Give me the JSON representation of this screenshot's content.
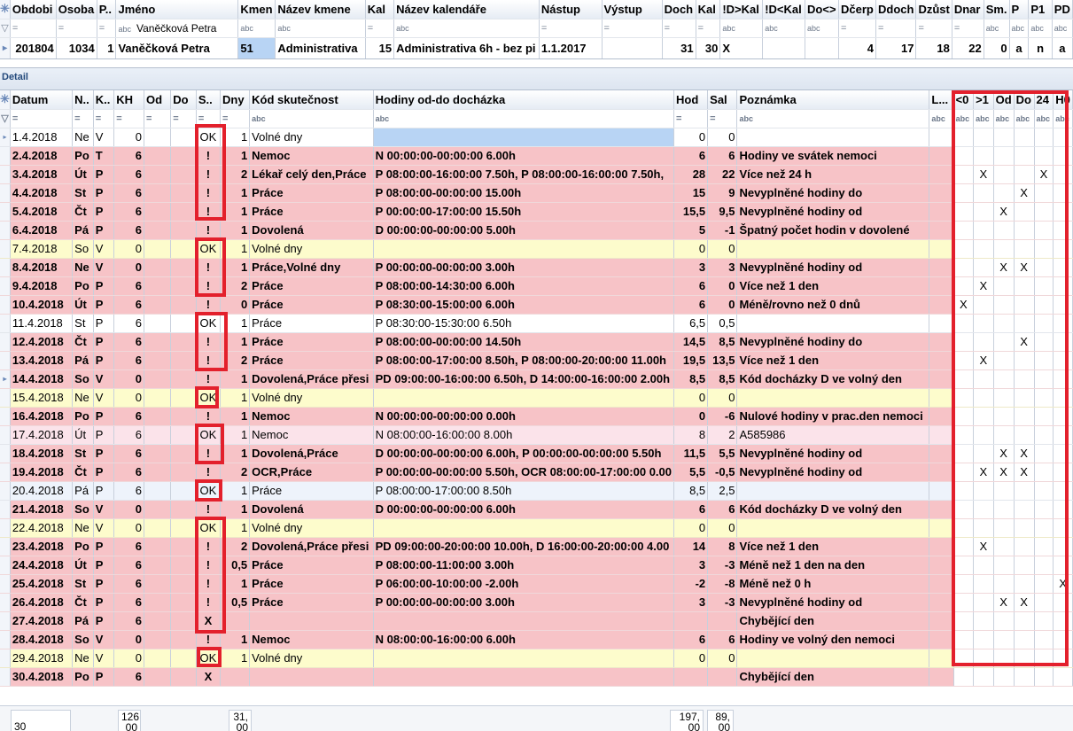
{
  "top_table": {
    "headers": [
      "Obdobi",
      "Osoba",
      "P..",
      "Jméno",
      "Kmen",
      "Název kmene",
      "Kal",
      "Název kalendáře",
      "Nástup",
      "Výstup",
      "Doch",
      "Kal",
      "!D>Kal",
      "!D<Kal",
      "Do<>",
      "Dčerp",
      "Ddoch",
      "Dzůst",
      "Dnar",
      "Sm.",
      "P",
      "P1",
      "PD"
    ],
    "filter": [
      "=",
      "=",
      "=",
      "Vaněčková Petra",
      "abc",
      "abc",
      "=",
      "abc",
      "=",
      "=",
      "=",
      "=",
      "abc",
      "abc",
      "abc",
      "=",
      "=",
      "=",
      "=",
      "abc",
      "abc",
      "abc",
      "abc"
    ],
    "filter_name_prefix": "abc",
    "row": [
      "201804",
      "1034",
      "1",
      "Vaněčková Petra",
      "51",
      "Administrativa",
      "15",
      "Administrativa 6h - bez pi",
      "1.1.2017",
      "",
      "31",
      "30",
      "X",
      "",
      "",
      "4",
      "17",
      "18",
      "22",
      "0",
      "a",
      "n",
      "a"
    ]
  },
  "detail_title": "Detail",
  "detail": {
    "headers": [
      "Datum",
      "N..",
      "K..",
      "KH",
      "Od",
      "Do",
      "S..",
      "Dny",
      "Kód skutečnost",
      "Hodiny od-do docházka",
      "Hod",
      "Sal",
      "Poznámka",
      "L...",
      "<0",
      ">1",
      "Od",
      "Do",
      "24",
      "H0"
    ],
    "filter": [
      "=",
      "=",
      "=",
      "=",
      "=",
      "=",
      "=",
      "=",
      "abc",
      "abc",
      "=",
      "=",
      "abc",
      "abc",
      "abc",
      "abc",
      "abc",
      "abc",
      "abc",
      "abc"
    ],
    "rows": [
      {
        "style": "white",
        "c": [
          "1.4.2018",
          "Ne",
          "V",
          "0",
          "",
          "",
          "OK",
          "1",
          "Volné dny",
          "",
          "0",
          "0",
          "",
          "",
          "",
          "",
          "",
          "",
          "",
          ""
        ]
      },
      {
        "style": "pink",
        "c": [
          "2.4.2018",
          "Po",
          "T",
          "6",
          "",
          "",
          "!",
          "1",
          "Nemoc",
          "N 00:00:00-00:00:00 6.00h",
          "6",
          "6",
          "Hodiny ve svátek nemoci",
          "",
          "",
          "",
          "",
          "",
          "",
          ""
        ]
      },
      {
        "style": "pink",
        "c": [
          "3.4.2018",
          "Út",
          "P",
          "6",
          "",
          "",
          "!",
          "2",
          "Lékař celý den,Práce",
          "P 08:00:00-16:00:00 7.50h, P 08:00:00-16:00:00 7.50h,",
          "28",
          "22",
          "Více než 24 h",
          "",
          "",
          "X",
          "",
          "",
          "X",
          ""
        ]
      },
      {
        "style": "pink",
        "c": [
          "4.4.2018",
          "St",
          "P",
          "6",
          "",
          "",
          "!",
          "1",
          "Práce",
          "P 08:00:00-00:00:00 15.00h",
          "15",
          "9",
          "Nevyplněné hodiny do",
          "",
          "",
          "",
          "",
          "X",
          "",
          ""
        ]
      },
      {
        "style": "pink",
        "c": [
          "5.4.2018",
          "Čt",
          "P",
          "6",
          "",
          "",
          "!",
          "1",
          "Práce",
          "P 00:00:00-17:00:00 15.50h",
          "15,5",
          "9,5",
          "Nevyplněné hodiny od",
          "",
          "",
          "",
          "X",
          "",
          "",
          ""
        ]
      },
      {
        "style": "pink",
        "c": [
          "6.4.2018",
          "Pá",
          "P",
          "6",
          "",
          "",
          "!",
          "1",
          "Dovolená",
          "D 00:00:00-00:00:00 5.00h",
          "5",
          "-1",
          "Špatný počet hodin v dovolené",
          "",
          "",
          "",
          "",
          "",
          "",
          ""
        ]
      },
      {
        "style": "yellow",
        "c": [
          "7.4.2018",
          "So",
          "V",
          "0",
          "",
          "",
          "OK",
          "1",
          "Volné dny",
          "",
          "0",
          "0",
          "",
          "",
          "",
          "",
          "",
          "",
          "",
          ""
        ]
      },
      {
        "style": "pink",
        "c": [
          "8.4.2018",
          "Ne",
          "V",
          "0",
          "",
          "",
          "!",
          "1",
          "Práce,Volné dny",
          "P 00:00:00-00:00:00 3.00h",
          "3",
          "3",
          "Nevyplněné hodiny od",
          "",
          "",
          "",
          "X",
          "X",
          "",
          ""
        ]
      },
      {
        "style": "pink",
        "c": [
          "9.4.2018",
          "Po",
          "P",
          "6",
          "",
          "",
          "!",
          "2",
          "Práce",
          "P 08:00:00-14:30:00 6.00h",
          "6",
          "0",
          "Více než 1 den",
          "",
          "",
          "X",
          "",
          "",
          "",
          ""
        ]
      },
      {
        "style": "pink",
        "c": [
          "10.4.2018",
          "Út",
          "P",
          "6",
          "",
          "",
          "!",
          "0",
          "Práce",
          "P 08:30:00-15:00:00 6.00h",
          "6",
          "0",
          "Méně/rovno než 0 dnů",
          "",
          "X",
          "",
          "",
          "",
          "",
          ""
        ]
      },
      {
        "style": "white",
        "c": [
          "11.4.2018",
          "St",
          "P",
          "6",
          "",
          "",
          "OK",
          "1",
          "Práce",
          "P 08:30:00-15:30:00 6.50h",
          "6,5",
          "0,5",
          "",
          "",
          "",
          "",
          "",
          "",
          "",
          ""
        ]
      },
      {
        "style": "pink",
        "c": [
          "12.4.2018",
          "Čt",
          "P",
          "6",
          "",
          "",
          "!",
          "1",
          "Práce",
          "P 08:00:00-00:00:00 14.50h",
          "14,5",
          "8,5",
          "Nevyplněné hodiny do",
          "",
          "",
          "",
          "",
          "X",
          "",
          ""
        ]
      },
      {
        "style": "pink",
        "c": [
          "13.4.2018",
          "Pá",
          "P",
          "6",
          "",
          "",
          "!",
          "2",
          "Práce",
          "P 08:00:00-17:00:00 8.50h, P 08:00:00-20:00:00 11.00h",
          "19,5",
          "13,5",
          "Více než 1 den",
          "",
          "",
          "X",
          "",
          "",
          "",
          ""
        ]
      },
      {
        "style": "pink",
        "c": [
          "14.4.2018",
          "So",
          "V",
          "0",
          "",
          "",
          "!",
          "1",
          "Dovolená,Práce přesi",
          "PD 09:00:00-16:00:00 6.50h, D 14:00:00-16:00:00 2.00h",
          "8,5",
          "8,5",
          "Kód docházky D ve volný den",
          "",
          "",
          "",
          "",
          "",
          "",
          ""
        ]
      },
      {
        "style": "yellow",
        "c": [
          "15.4.2018",
          "Ne",
          "V",
          "0",
          "",
          "",
          "OK",
          "1",
          "Volné dny",
          "",
          "0",
          "0",
          "",
          "",
          "",
          "",
          "",
          "",
          "",
          ""
        ]
      },
      {
        "style": "pink",
        "c": [
          "16.4.2018",
          "Po",
          "P",
          "6",
          "",
          "",
          "!",
          "1",
          "Nemoc",
          "N 00:00:00-00:00:00 0.00h",
          "0",
          "-6",
          "Nulové hodiny v prac.den nemoci",
          "",
          "",
          "",
          "",
          "",
          "",
          ""
        ]
      },
      {
        "style": "lpink",
        "c": [
          "17.4.2018",
          "Út",
          "P",
          "6",
          "",
          "",
          "OK",
          "1",
          "Nemoc",
          "N 08:00:00-16:00:00 8.00h",
          "8",
          "2",
          "A585986",
          "",
          "",
          "",
          "",
          "",
          "",
          ""
        ]
      },
      {
        "style": "pink",
        "c": [
          "18.4.2018",
          "St",
          "P",
          "6",
          "",
          "",
          "!",
          "1",
          "Dovolená,Práce",
          "D 00:00:00-00:00:00 6.00h, P 00:00:00-00:00:00 5.50h",
          "11,5",
          "5,5",
          "Nevyplněné hodiny od",
          "",
          "",
          "",
          "X",
          "X",
          "",
          ""
        ]
      },
      {
        "style": "pink",
        "c": [
          "19.4.2018",
          "Čt",
          "P",
          "6",
          "",
          "",
          "!",
          "2",
          "OCR,Práce",
          "P 00:00:00-00:00:00 5.50h, OCR 08:00:00-17:00:00 0.00",
          "5,5",
          "-0,5",
          "Nevyplněné hodiny od",
          "",
          "",
          "X",
          "X",
          "X",
          "",
          ""
        ]
      },
      {
        "style": "blue",
        "c": [
          "20.4.2018",
          "Pá",
          "P",
          "6",
          "",
          "",
          "OK",
          "1",
          "Práce",
          "P 08:00:00-17:00:00 8.50h",
          "8,5",
          "2,5",
          "",
          "",
          "",
          "",
          "",
          "",
          "",
          ""
        ]
      },
      {
        "style": "pink",
        "c": [
          "21.4.2018",
          "So",
          "V",
          "0",
          "",
          "",
          "!",
          "1",
          "Dovolená",
          "D 00:00:00-00:00:00 6.00h",
          "6",
          "6",
          "Kód docházky D ve volný den",
          "",
          "",
          "",
          "",
          "",
          "",
          ""
        ]
      },
      {
        "style": "yellow",
        "c": [
          "22.4.2018",
          "Ne",
          "V",
          "0",
          "",
          "",
          "OK",
          "1",
          "Volné dny",
          "",
          "0",
          "0",
          "",
          "",
          "",
          "",
          "",
          "",
          "",
          ""
        ]
      },
      {
        "style": "pink",
        "c": [
          "23.4.2018",
          "Po",
          "P",
          "6",
          "",
          "",
          "!",
          "2",
          "Dovolená,Práce přesi",
          "PD 09:00:00-20:00:00 10.00h, D 16:00:00-20:00:00 4.00",
          "14",
          "8",
          "Více než 1 den",
          "",
          "",
          "X",
          "",
          "",
          "",
          ""
        ]
      },
      {
        "style": "pink",
        "c": [
          "24.4.2018",
          "Út",
          "P",
          "6",
          "",
          "",
          "!",
          "0,5",
          "Práce",
          "P 08:00:00-11:00:00 3.00h",
          "3",
          "-3",
          "Méně než 1 den na den",
          "",
          "",
          "",
          "",
          "",
          "",
          ""
        ]
      },
      {
        "style": "pink",
        "c": [
          "25.4.2018",
          "St",
          "P",
          "6",
          "",
          "",
          "!",
          "1",
          "Práce",
          "P 06:00:00-10:00:00 -2.00h",
          "-2",
          "-8",
          "Méně než 0 h",
          "",
          "",
          "",
          "",
          "",
          "",
          "X"
        ]
      },
      {
        "style": "pink",
        "c": [
          "26.4.2018",
          "Čt",
          "P",
          "6",
          "",
          "",
          "!",
          "0,5",
          "Práce",
          "P 00:00:00-00:00:00 3.00h",
          "3",
          "-3",
          "Nevyplněné hodiny od",
          "",
          "",
          "",
          "X",
          "X",
          "",
          ""
        ]
      },
      {
        "style": "pink",
        "c": [
          "27.4.2018",
          "Pá",
          "P",
          "6",
          "",
          "",
          "X",
          "",
          "",
          "",
          "",
          "",
          "Chybějící den",
          "",
          "",
          "",
          "",
          "",
          "",
          ""
        ]
      },
      {
        "style": "pink",
        "c": [
          "28.4.2018",
          "So",
          "V",
          "0",
          "",
          "",
          "!",
          "1",
          "Nemoc",
          "N 08:00:00-16:00:00 6.00h",
          "6",
          "6",
          "Hodiny ve volný den nemoci",
          "",
          "",
          "",
          "",
          "",
          "",
          ""
        ]
      },
      {
        "style": "yellow",
        "c": [
          "29.4.2018",
          "Ne",
          "V",
          "0",
          "",
          "",
          "OK",
          "1",
          "Volné dny",
          "",
          "0",
          "0",
          "",
          "",
          "",
          "",
          "",
          "",
          "",
          ""
        ]
      },
      {
        "style": "pink",
        "c": [
          "30.4.2018",
          "Po",
          "P",
          "6",
          "",
          "",
          "X",
          "",
          "",
          "",
          "",
          "",
          "Chybějící den",
          "",
          "",
          "",
          "",
          "",
          "",
          ""
        ]
      }
    ]
  },
  "footer": {
    "count": "30",
    "kh_sum": "126\n00",
    "dny_sum": "31,\n00",
    "hod_sum": "197,\n00",
    "sal_sum": "89,\n00"
  },
  "colors": {
    "error_row": "#f7c3c7",
    "weekend_row": "#fdfccc",
    "highlight_box": "#e3202c",
    "selection": "#b8d4f4"
  }
}
